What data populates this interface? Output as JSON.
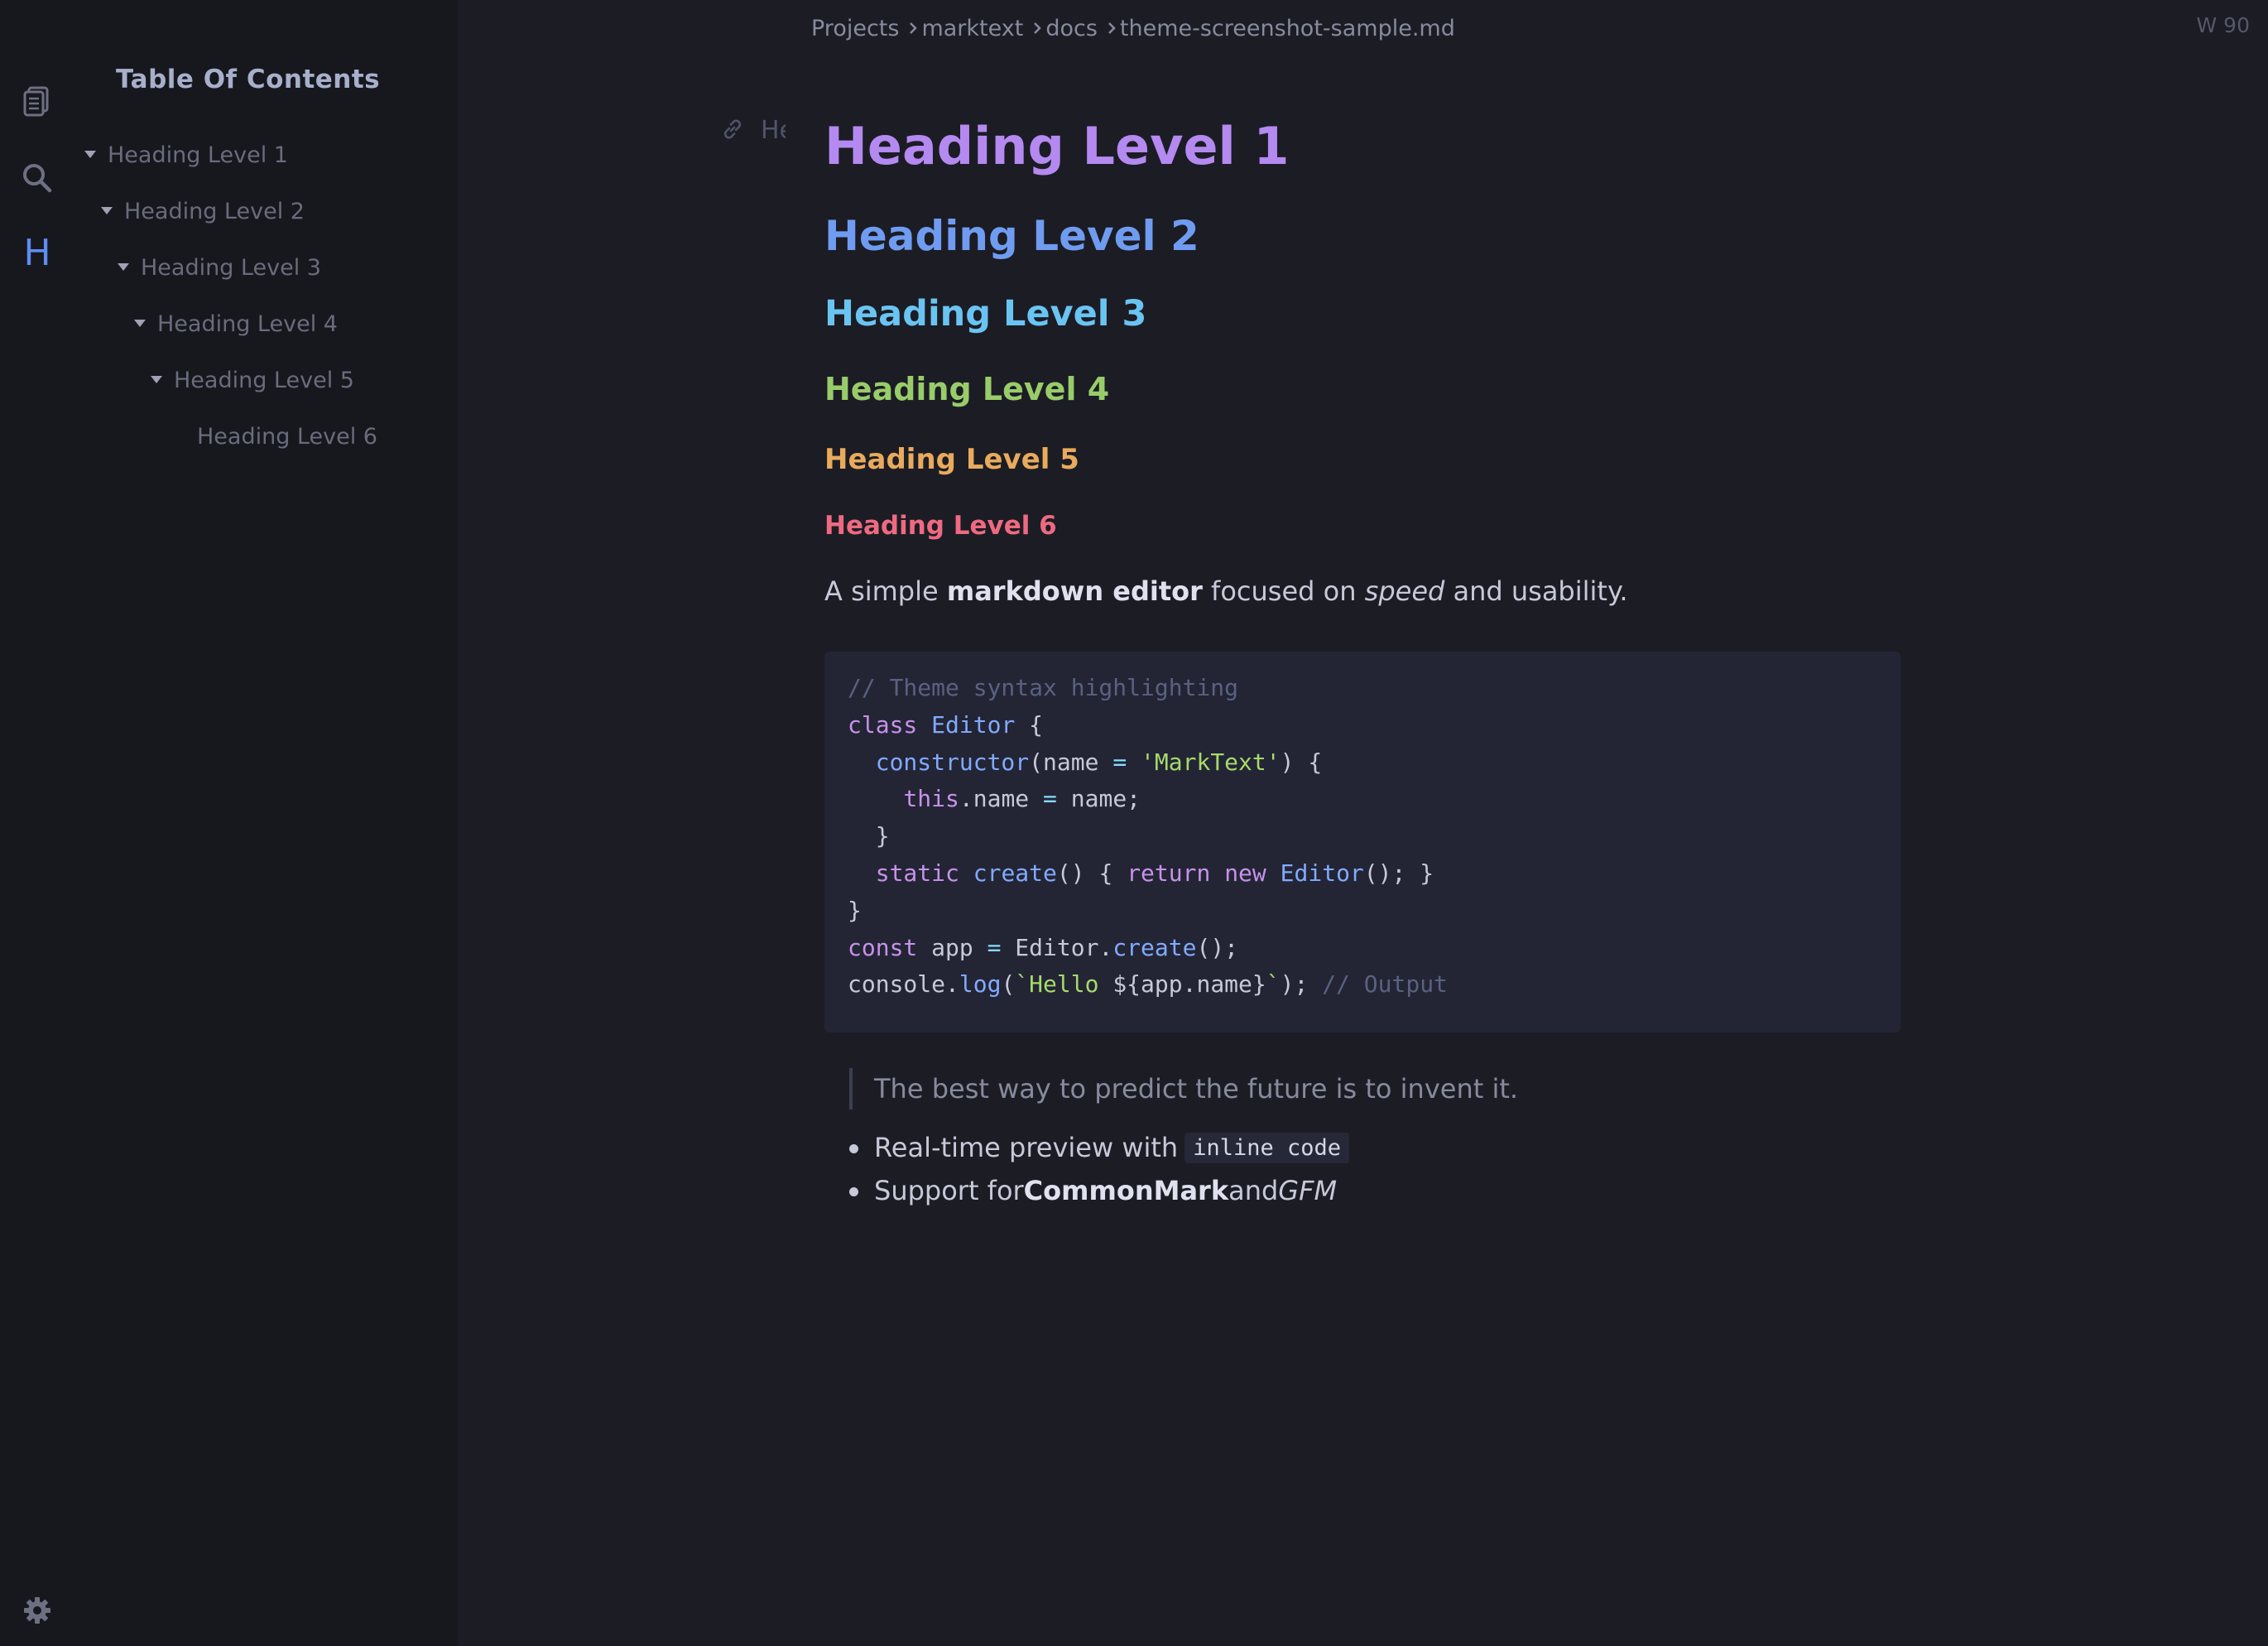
{
  "activity_bar": {
    "icons": [
      "files-icon",
      "search-icon",
      "toc-icon",
      "settings-icon"
    ],
    "toc_letter": "H",
    "accent": "#5f8df0"
  },
  "sidebar": {
    "title": "Table Of Contents",
    "items": [
      {
        "label": "Heading Level 1",
        "has_caret": true
      },
      {
        "label": "Heading Level 2",
        "has_caret": true
      },
      {
        "label": "Heading Level 3",
        "has_caret": true
      },
      {
        "label": "Heading Level 4",
        "has_caret": true
      },
      {
        "label": "Heading Level 5",
        "has_caret": true
      },
      {
        "label": "Heading Level 6",
        "has_caret": false
      }
    ]
  },
  "breadcrumb": [
    "Projects",
    "marktext",
    "docs",
    "theme-screenshot-sample.md"
  ],
  "word_count": "W 90",
  "heading_tools": {
    "label": "He"
  },
  "document": {
    "headings": [
      {
        "level": 1,
        "text": "Heading Level 1",
        "color": "#b489f0"
      },
      {
        "level": 2,
        "text": "Heading Level 2",
        "color": "#6f9cf0"
      },
      {
        "level": 3,
        "text": "Heading Level 3",
        "color": "#6ac4f2"
      },
      {
        "level": 4,
        "text": "Heading Level 4",
        "color": "#98cc6a"
      },
      {
        "level": 5,
        "text": "Heading Level 5",
        "color": "#e8aa5c"
      },
      {
        "level": 6,
        "text": "Heading Level 6",
        "color": "#ee6a80"
      }
    ],
    "paragraph": {
      "p1": "A simple ",
      "bold": "markdown editor",
      "p2": " focused on ",
      "italic": "speed",
      "p3": " and usability."
    },
    "code_lines": [
      [
        {
          "t": "// Theme syntax highlighting",
          "c": "comment"
        }
      ],
      [
        {
          "t": "class",
          "c": "kw"
        },
        {
          "t": " ",
          "c": "plain"
        },
        {
          "t": "Editor",
          "c": "fn"
        },
        {
          "t": " {",
          "c": "plain"
        }
      ],
      [
        {
          "t": "  ",
          "c": "plain"
        },
        {
          "t": "constructor",
          "c": "fn"
        },
        {
          "t": "(name ",
          "c": "plain"
        },
        {
          "t": "=",
          "c": "op"
        },
        {
          "t": " ",
          "c": "plain"
        },
        {
          "t": "'MarkText'",
          "c": "str"
        },
        {
          "t": ") {",
          "c": "plain"
        }
      ],
      [
        {
          "t": "    ",
          "c": "plain"
        },
        {
          "t": "this",
          "c": "kw"
        },
        {
          "t": ".name ",
          "c": "plain"
        },
        {
          "t": "=",
          "c": "op"
        },
        {
          "t": " name;",
          "c": "plain"
        }
      ],
      [
        {
          "t": "  }",
          "c": "plain"
        }
      ],
      [
        {
          "t": "  ",
          "c": "plain"
        },
        {
          "t": "static",
          "c": "kw"
        },
        {
          "t": " ",
          "c": "plain"
        },
        {
          "t": "create",
          "c": "fn"
        },
        {
          "t": "() { ",
          "c": "plain"
        },
        {
          "t": "return",
          "c": "kw"
        },
        {
          "t": " ",
          "c": "plain"
        },
        {
          "t": "new",
          "c": "kw"
        },
        {
          "t": " ",
          "c": "plain"
        },
        {
          "t": "Editor",
          "c": "fn"
        },
        {
          "t": "(); }",
          "c": "plain"
        }
      ],
      [
        {
          "t": "}",
          "c": "plain"
        }
      ],
      [
        {
          "t": "const",
          "c": "kw"
        },
        {
          "t": " app ",
          "c": "plain"
        },
        {
          "t": "=",
          "c": "op"
        },
        {
          "t": " Editor.",
          "c": "plain"
        },
        {
          "t": "create",
          "c": "fn"
        },
        {
          "t": "();",
          "c": "plain"
        }
      ],
      [
        {
          "t": "console.",
          "c": "plain"
        },
        {
          "t": "log",
          "c": "fn"
        },
        {
          "t": "(",
          "c": "plain"
        },
        {
          "t": "`Hello ",
          "c": "str"
        },
        {
          "t": "${app.name}",
          "c": "plain"
        },
        {
          "t": "`",
          "c": "str"
        },
        {
          "t": "); ",
          "c": "plain"
        },
        {
          "t": "// Output",
          "c": "comment"
        }
      ]
    ],
    "blockquote": "The best way to predict the future is to invent it.",
    "list": {
      "item1_text": "Real-time preview with",
      "item1_code": "inline code",
      "item2_p1": "Support for ",
      "item2_bold": "CommonMark",
      "item2_p2": " and ",
      "item2_italic": "GFM"
    }
  }
}
